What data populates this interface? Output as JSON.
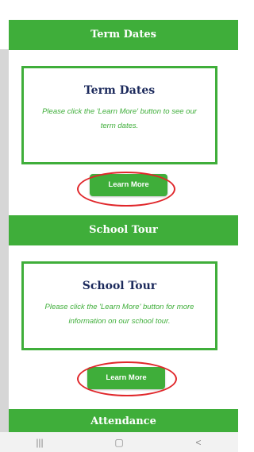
{
  "sections": [
    {
      "band_title": "Term Dates",
      "card_title": "Term Dates",
      "card_text": "Please click the 'Learn More' button to see our term dates.",
      "button_label": "Learn More"
    },
    {
      "band_title": "School Tour",
      "card_title": "School Tour",
      "card_text": "Please click the 'Learn More' button for more information on our school tour.",
      "button_label": "Learn More"
    },
    {
      "band_title": "Attendance"
    }
  ],
  "navbar": {
    "recent_glyph": "|||",
    "home_glyph": "▢",
    "back_glyph": "<"
  },
  "colors": {
    "accent_green": "#3fae3a",
    "title_navy": "#1c2a5c",
    "highlight_red": "#e0262a"
  }
}
